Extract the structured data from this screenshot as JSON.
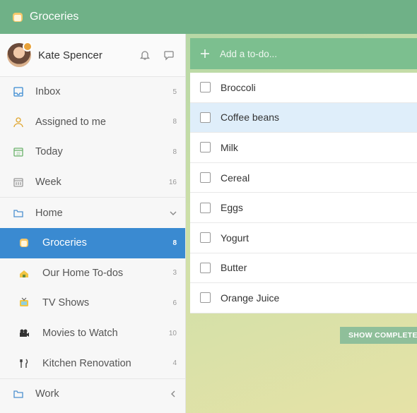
{
  "header": {
    "title": "Groceries",
    "icon": "bread-icon"
  },
  "profile": {
    "name": "Kate Spencer",
    "icons": [
      "bell-icon",
      "chat-bubble-icon"
    ]
  },
  "sidebar": {
    "items": [
      {
        "label": "Inbox",
        "count": "5",
        "icon": "inbox-icon"
      },
      {
        "label": "Assigned to me",
        "count": "8",
        "icon": "person-icon"
      },
      {
        "label": "Today",
        "count": "8",
        "icon": "calendar-today-icon"
      },
      {
        "label": "Week",
        "count": "16",
        "icon": "calendar-week-icon"
      },
      {
        "label": "Home",
        "count": "",
        "icon": "folder-icon",
        "expanded": true
      },
      {
        "label": "Groceries",
        "count": "8",
        "icon": "bread-icon",
        "active": true
      },
      {
        "label": "Our Home To-dos",
        "count": "3",
        "icon": "house-icon"
      },
      {
        "label": "TV Shows",
        "count": "6",
        "icon": "tv-icon"
      },
      {
        "label": "Movies to Watch",
        "count": "10",
        "icon": "camera-icon"
      },
      {
        "label": "Kitchen Renovation",
        "count": "4",
        "icon": "utensils-icon"
      },
      {
        "label": "Work",
        "count": "",
        "icon": "folder-icon",
        "expanded": false
      }
    ]
  },
  "main": {
    "add_placeholder": "Add a to-do...",
    "tasks": [
      {
        "text": "Broccoli"
      },
      {
        "text": "Coffee beans",
        "highlighted": true
      },
      {
        "text": "Milk"
      },
      {
        "text": "Cereal"
      },
      {
        "text": "Eggs"
      },
      {
        "text": "Yogurt"
      },
      {
        "text": "Butter"
      },
      {
        "text": "Orange Juice"
      }
    ],
    "show_completed_label": "SHOW COMPLETED TO-DOS"
  },
  "colors": {
    "topbar": "#6fb187",
    "active": "#3a8ad1",
    "add_bar": "#7cbf8f",
    "highlight": "#dfeefa"
  }
}
